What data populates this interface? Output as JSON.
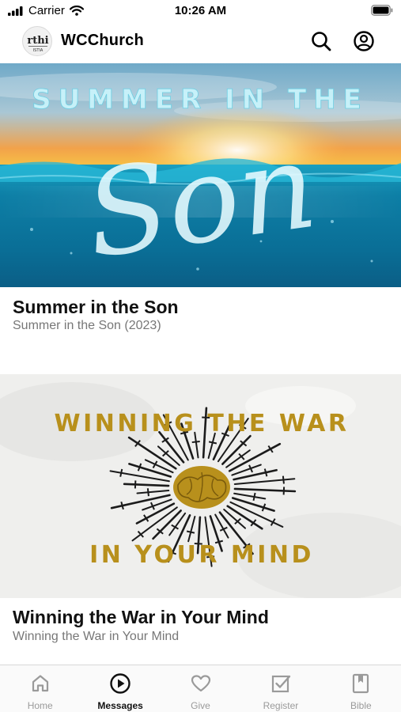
{
  "status_bar": {
    "carrier": "Carrier",
    "time": "10:26 AM",
    "icons": [
      "signal-icon",
      "wifi-icon",
      "battery-icon"
    ]
  },
  "header": {
    "logo_text": "rthi",
    "logo_subtext": "ISTIA",
    "title": "WCChurch",
    "icons": [
      "search-icon",
      "profile-icon"
    ]
  },
  "feed": [
    {
      "image_text_top": "SUMMER IN THE",
      "image_text_script": "Son",
      "title": "Summer in the Son",
      "subtitle": "Summer in the Son (2023)"
    },
    {
      "image_text_top": "WINNING THE WAR",
      "image_text_bottom": "IN YOUR MIND",
      "title": "Winning the War in Your Mind",
      "subtitle": "Winning the War in Your Mind"
    }
  ],
  "tabs": [
    {
      "label": "Home",
      "icon": "home-icon",
      "active": false
    },
    {
      "label": "Messages",
      "icon": "play-circle-icon",
      "active": true
    },
    {
      "label": "Give",
      "icon": "heart-icon",
      "active": false
    },
    {
      "label": "Register",
      "icon": "checkbox-icon",
      "active": false
    },
    {
      "label": "Bible",
      "icon": "book-icon",
      "active": false
    }
  ],
  "colors": {
    "active_tab": "#111111",
    "inactive_tab": "#9a9a9a",
    "banner_gold": "#b8901c"
  }
}
